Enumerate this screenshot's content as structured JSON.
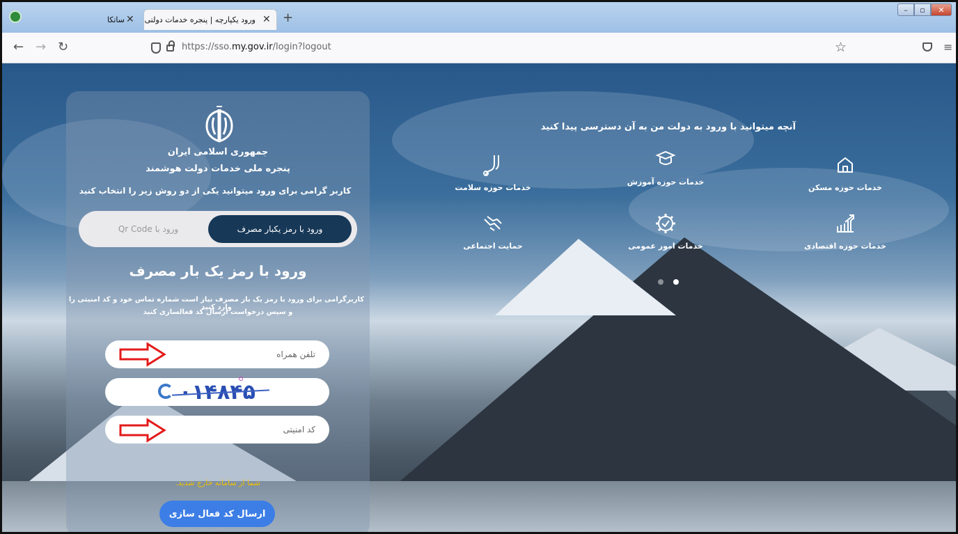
{
  "browser": {
    "tabs": [
      {
        "label": "ساتکا"
      },
      {
        "label": "ورود یکپارچه | پنجره خدمات دولتی"
      }
    ],
    "url_prefix": "https://sso.",
    "url_host": "my.gov.ir",
    "url_path": "/login?logout"
  },
  "login": {
    "gov_name": "جمهوری اسلامی ایران",
    "gov_subtitle": "پنجره ملی خدمات دولت هوشمند",
    "choose_text": "کاربر گرامی برای ورود میتوانید یکی از دو روش زیر را انتخاب کنید",
    "method_otp": "ورود با رمز یکبار مصرف",
    "method_qr": "ورود با Qr Code",
    "heading": "ورود با رمز یک بار مصرف",
    "desc_line1": "کاربرگرامی برای ورود با رمز یک بار مصرف نیاز است شماره تماس خود و کد امنیتی را وارد کنید",
    "desc_line2": "و سپس درخواست ارسال کد فعالسازی کنید",
    "phone_placeholder": "تلفن همراه",
    "captcha": "۰۱۴۸۴۵",
    "security_placeholder": "کد امنیتی",
    "logout_message": "شما از سامانه خارج شدید.",
    "send_button": "ارسال کد فعال سازی"
  },
  "services": {
    "heading": "آنچه میتوانید با ورود به دولت من به آن دسترسی پیدا کنید",
    "items": [
      {
        "label": "خدمات حوزه مسکن",
        "icon": "home-icon"
      },
      {
        "label": "خدمات حوزه آموزش",
        "icon": "graduation-cap-icon"
      },
      {
        "label": "خدمات حوزه سلامت",
        "icon": "stethoscope-icon"
      },
      {
        "label": "خدمات حوزه اقتصادی",
        "icon": "chart-growth-icon"
      },
      {
        "label": "خدمات امور عمومی",
        "icon": "gear-check-icon"
      },
      {
        "label": "حمایت اجتماعی",
        "icon": "helping-hands-icon"
      }
    ]
  },
  "colors": {
    "primary_button": "#173857",
    "send_button": "#3d7ee6",
    "logout_text": "#f2c200",
    "annotation_arrow": "#e31b1b"
  }
}
